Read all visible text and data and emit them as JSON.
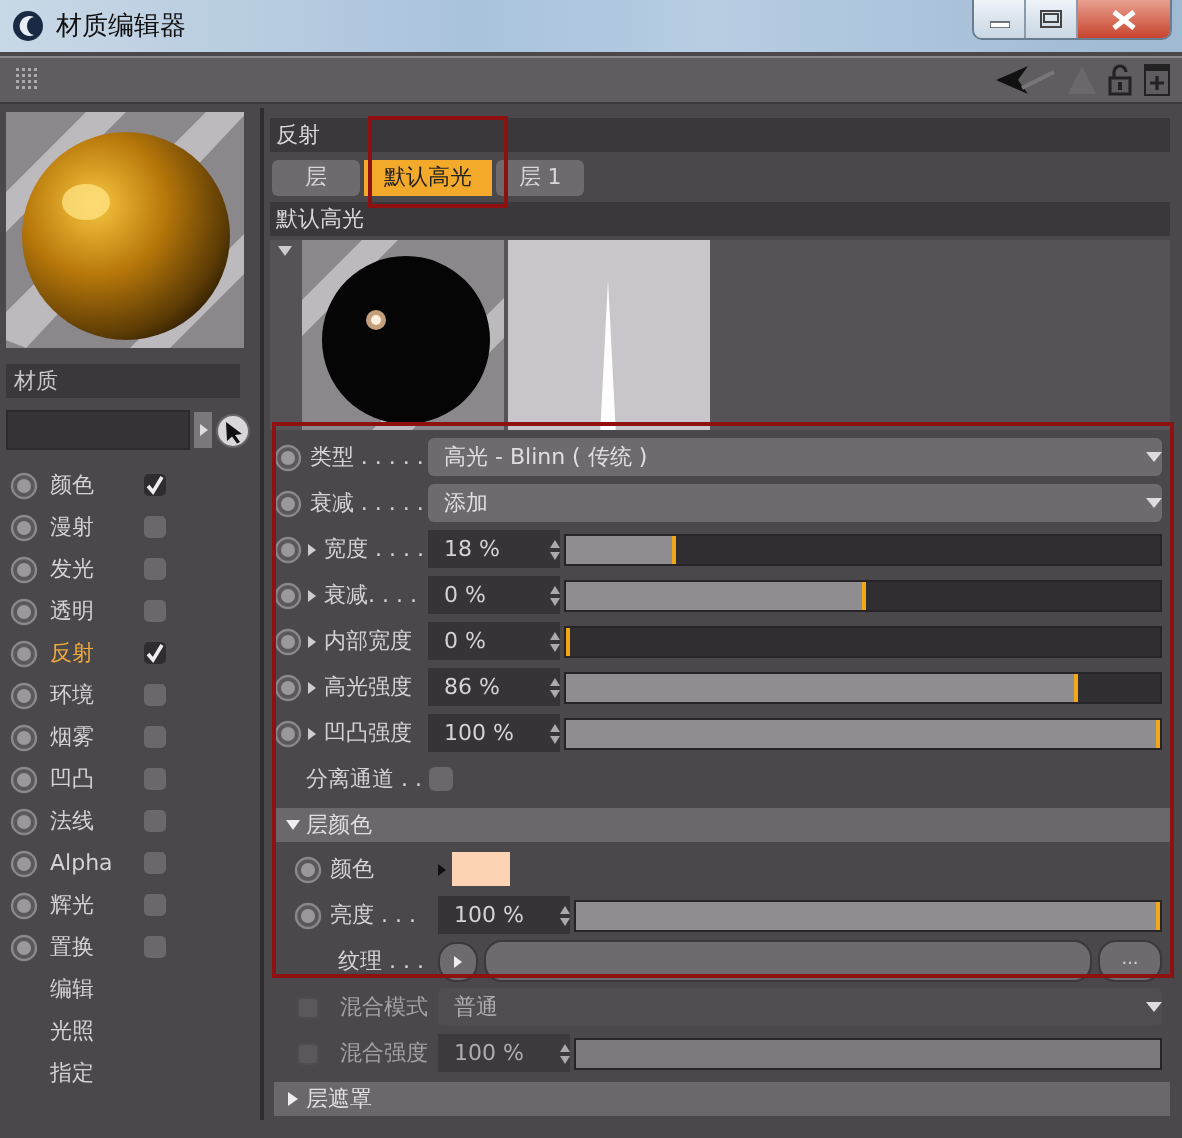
{
  "window": {
    "title": "材质编辑器"
  },
  "material": {
    "name": "材质"
  },
  "channels": [
    {
      "label": "颜色",
      "kind": "toggle",
      "checked": true,
      "selected": false
    },
    {
      "label": "漫射",
      "kind": "toggle",
      "checked": false,
      "selected": false
    },
    {
      "label": "发光",
      "kind": "toggle",
      "checked": false,
      "selected": false
    },
    {
      "label": "透明",
      "kind": "toggle",
      "checked": false,
      "selected": false
    },
    {
      "label": "反射",
      "kind": "toggle",
      "checked": true,
      "selected": true
    },
    {
      "label": "环境",
      "kind": "toggle",
      "checked": false,
      "selected": false
    },
    {
      "label": "烟雾",
      "kind": "toggle",
      "checked": false,
      "selected": false
    },
    {
      "label": "凹凸",
      "kind": "toggle",
      "checked": false,
      "selected": false
    },
    {
      "label": "法线",
      "kind": "toggle",
      "checked": false,
      "selected": false
    },
    {
      "label": "Alpha",
      "kind": "toggle",
      "checked": false,
      "selected": false
    },
    {
      "label": "辉光",
      "kind": "toggle",
      "checked": false,
      "selected": false
    },
    {
      "label": "置换",
      "kind": "toggle",
      "checked": false,
      "selected": false
    },
    {
      "label": "编辑",
      "kind": "plain",
      "selected": false
    },
    {
      "label": "光照",
      "kind": "plain",
      "selected": false
    },
    {
      "label": "指定",
      "kind": "plain",
      "selected": false
    }
  ],
  "section": {
    "title": "反射"
  },
  "tabs": [
    {
      "label": "层",
      "selected": false
    },
    {
      "label": "默认高光",
      "selected": true
    },
    {
      "label": "层 1",
      "selected": false
    }
  ],
  "layer": {
    "title": "默认高光"
  },
  "params": [
    {
      "kind": "dropdown",
      "label": "类型 . . . . .",
      "value": "高光 - Blinn ( 传统 )"
    },
    {
      "kind": "dropdown",
      "label": "衰减 . . . . .",
      "value": "添加"
    },
    {
      "kind": "slider",
      "label": "宽度 . . . .",
      "value": "18 %",
      "level": 0.18
    },
    {
      "kind": "slider",
      "label": "衰减. . . .",
      "value": "0 %",
      "level": 0.5
    },
    {
      "kind": "slider",
      "label": "内部宽度",
      "value": "0 %",
      "level": 0
    },
    {
      "kind": "slider",
      "label": "高光强度",
      "value": "86 %",
      "level": 0.86
    },
    {
      "kind": "slider",
      "label": "凹凸强度",
      "value": "100 %",
      "level": 1
    },
    {
      "kind": "checkbox",
      "label": "分离通道 . .",
      "checked": false
    }
  ],
  "layer_color": {
    "title": "层颜色",
    "expanded": true,
    "rows": [
      {
        "kind": "color",
        "label": "颜色",
        "color": "#fdd3b4"
      },
      {
        "kind": "slider",
        "label": "亮度 . . .",
        "value": "100 %",
        "level": 1
      },
      {
        "kind": "texture",
        "label": "纹理 . . .",
        "button": "..."
      },
      {
        "kind": "dropdown",
        "label": "混合模式",
        "value": "普通",
        "disabled": true,
        "checked": false
      },
      {
        "kind": "slider",
        "label": "混合强度",
        "value": "100 %",
        "level": 1,
        "disabled": true,
        "checked": false
      }
    ]
  },
  "layer_mask": {
    "title": "层遮罩",
    "expanded": false
  }
}
